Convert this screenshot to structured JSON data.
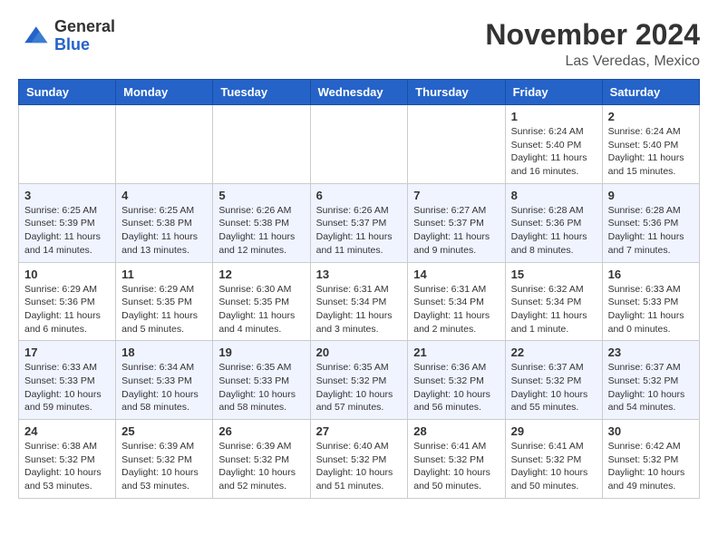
{
  "header": {
    "logo_general": "General",
    "logo_blue": "Blue",
    "month_title": "November 2024",
    "location": "Las Veredas, Mexico"
  },
  "days_of_week": [
    "Sunday",
    "Monday",
    "Tuesday",
    "Wednesday",
    "Thursday",
    "Friday",
    "Saturday"
  ],
  "weeks": [
    [
      {
        "day": "",
        "info": ""
      },
      {
        "day": "",
        "info": ""
      },
      {
        "day": "",
        "info": ""
      },
      {
        "day": "",
        "info": ""
      },
      {
        "day": "",
        "info": ""
      },
      {
        "day": "1",
        "info": "Sunrise: 6:24 AM\nSunset: 5:40 PM\nDaylight: 11 hours and 16 minutes."
      },
      {
        "day": "2",
        "info": "Sunrise: 6:24 AM\nSunset: 5:40 PM\nDaylight: 11 hours and 15 minutes."
      }
    ],
    [
      {
        "day": "3",
        "info": "Sunrise: 6:25 AM\nSunset: 5:39 PM\nDaylight: 11 hours and 14 minutes."
      },
      {
        "day": "4",
        "info": "Sunrise: 6:25 AM\nSunset: 5:38 PM\nDaylight: 11 hours and 13 minutes."
      },
      {
        "day": "5",
        "info": "Sunrise: 6:26 AM\nSunset: 5:38 PM\nDaylight: 11 hours and 12 minutes."
      },
      {
        "day": "6",
        "info": "Sunrise: 6:26 AM\nSunset: 5:37 PM\nDaylight: 11 hours and 11 minutes."
      },
      {
        "day": "7",
        "info": "Sunrise: 6:27 AM\nSunset: 5:37 PM\nDaylight: 11 hours and 9 minutes."
      },
      {
        "day": "8",
        "info": "Sunrise: 6:28 AM\nSunset: 5:36 PM\nDaylight: 11 hours and 8 minutes."
      },
      {
        "day": "9",
        "info": "Sunrise: 6:28 AM\nSunset: 5:36 PM\nDaylight: 11 hours and 7 minutes."
      }
    ],
    [
      {
        "day": "10",
        "info": "Sunrise: 6:29 AM\nSunset: 5:36 PM\nDaylight: 11 hours and 6 minutes."
      },
      {
        "day": "11",
        "info": "Sunrise: 6:29 AM\nSunset: 5:35 PM\nDaylight: 11 hours and 5 minutes."
      },
      {
        "day": "12",
        "info": "Sunrise: 6:30 AM\nSunset: 5:35 PM\nDaylight: 11 hours and 4 minutes."
      },
      {
        "day": "13",
        "info": "Sunrise: 6:31 AM\nSunset: 5:34 PM\nDaylight: 11 hours and 3 minutes."
      },
      {
        "day": "14",
        "info": "Sunrise: 6:31 AM\nSunset: 5:34 PM\nDaylight: 11 hours and 2 minutes."
      },
      {
        "day": "15",
        "info": "Sunrise: 6:32 AM\nSunset: 5:34 PM\nDaylight: 11 hours and 1 minute."
      },
      {
        "day": "16",
        "info": "Sunrise: 6:33 AM\nSunset: 5:33 PM\nDaylight: 11 hours and 0 minutes."
      }
    ],
    [
      {
        "day": "17",
        "info": "Sunrise: 6:33 AM\nSunset: 5:33 PM\nDaylight: 10 hours and 59 minutes."
      },
      {
        "day": "18",
        "info": "Sunrise: 6:34 AM\nSunset: 5:33 PM\nDaylight: 10 hours and 58 minutes."
      },
      {
        "day": "19",
        "info": "Sunrise: 6:35 AM\nSunset: 5:33 PM\nDaylight: 10 hours and 58 minutes."
      },
      {
        "day": "20",
        "info": "Sunrise: 6:35 AM\nSunset: 5:32 PM\nDaylight: 10 hours and 57 minutes."
      },
      {
        "day": "21",
        "info": "Sunrise: 6:36 AM\nSunset: 5:32 PM\nDaylight: 10 hours and 56 minutes."
      },
      {
        "day": "22",
        "info": "Sunrise: 6:37 AM\nSunset: 5:32 PM\nDaylight: 10 hours and 55 minutes."
      },
      {
        "day": "23",
        "info": "Sunrise: 6:37 AM\nSunset: 5:32 PM\nDaylight: 10 hours and 54 minutes."
      }
    ],
    [
      {
        "day": "24",
        "info": "Sunrise: 6:38 AM\nSunset: 5:32 PM\nDaylight: 10 hours and 53 minutes."
      },
      {
        "day": "25",
        "info": "Sunrise: 6:39 AM\nSunset: 5:32 PM\nDaylight: 10 hours and 53 minutes."
      },
      {
        "day": "26",
        "info": "Sunrise: 6:39 AM\nSunset: 5:32 PM\nDaylight: 10 hours and 52 minutes."
      },
      {
        "day": "27",
        "info": "Sunrise: 6:40 AM\nSunset: 5:32 PM\nDaylight: 10 hours and 51 minutes."
      },
      {
        "day": "28",
        "info": "Sunrise: 6:41 AM\nSunset: 5:32 PM\nDaylight: 10 hours and 50 minutes."
      },
      {
        "day": "29",
        "info": "Sunrise: 6:41 AM\nSunset: 5:32 PM\nDaylight: 10 hours and 50 minutes."
      },
      {
        "day": "30",
        "info": "Sunrise: 6:42 AM\nSunset: 5:32 PM\nDaylight: 10 hours and 49 minutes."
      }
    ]
  ]
}
